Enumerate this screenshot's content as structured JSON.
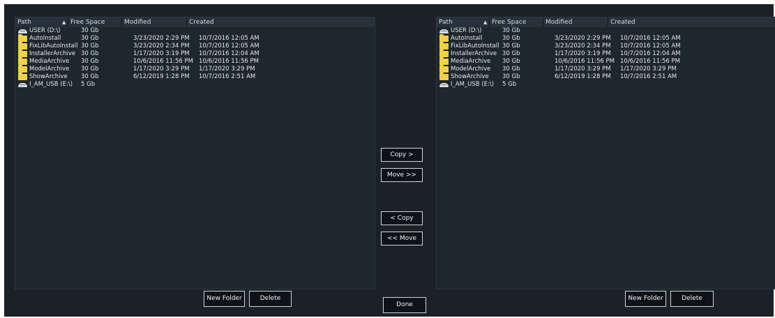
{
  "columns": {
    "path": "Path",
    "free_space": "Free Space",
    "modified": "Modified",
    "created": "Created"
  },
  "left_pane": {
    "rows": [
      {
        "icon": "drive-icon",
        "path": "USER (D:\\)",
        "free": "30 Gb",
        "modified": "",
        "created": ""
      },
      {
        "icon": "folder-icon",
        "path": "AutoInstall",
        "free": "30 Gb",
        "modified": "3/23/2020 2:29 PM",
        "created": "10/7/2016 12:05 AM"
      },
      {
        "icon": "folder-icon",
        "path": "FixLibAutoInstall",
        "free": "30 Gb",
        "modified": "3/23/2020 2:34 PM",
        "created": "10/7/2016 12:05 AM"
      },
      {
        "icon": "folder-icon",
        "path": "InstallerArchive",
        "free": "30 Gb",
        "modified": "1/17/2020 3:19 PM",
        "created": "10/7/2016 12:04 AM"
      },
      {
        "icon": "folder-icon",
        "path": "MediaArchive",
        "free": "30 Gb",
        "modified": "10/6/2016 11:56 PM",
        "created": "10/6/2016 11:56 PM"
      },
      {
        "icon": "folder-icon",
        "path": "ModelArchive",
        "free": "30 Gb",
        "modified": "1/17/2020 3:29 PM",
        "created": "1/17/2020 3:29 PM"
      },
      {
        "icon": "folder-icon",
        "path": "ShowArchive",
        "free": "30 Gb",
        "modified": "6/12/2019 1:28 PM",
        "created": "10/7/2016 2:51 AM"
      },
      {
        "icon": "drive-icon",
        "path": "I_AM_USB (E:\\)",
        "free": "5 Gb",
        "modified": "",
        "created": ""
      }
    ],
    "new_folder": "New Folder",
    "delete": "Delete"
  },
  "right_pane": {
    "rows": [
      {
        "icon": "drive-icon",
        "path": "USER (D:\\)",
        "free": "30 Gb",
        "modified": "",
        "created": ""
      },
      {
        "icon": "folder-icon",
        "path": "AutoInstall",
        "free": "30 Gb",
        "modified": "3/23/2020 2:29 PM",
        "created": "10/7/2016 12:05 AM"
      },
      {
        "icon": "folder-icon",
        "path": "FixLibAutoInstall",
        "free": "30 Gb",
        "modified": "3/23/2020 2:34 PM",
        "created": "10/7/2016 12:05 AM"
      },
      {
        "icon": "folder-icon",
        "path": "InstallerArchive",
        "free": "30 Gb",
        "modified": "1/17/2020 3:19 PM",
        "created": "10/7/2016 12:04 AM"
      },
      {
        "icon": "folder-icon",
        "path": "MediaArchive",
        "free": "30 Gb",
        "modified": "10/6/2016 11:56 PM",
        "created": "10/6/2016 11:56 PM"
      },
      {
        "icon": "folder-icon",
        "path": "ModelArchive",
        "free": "30 Gb",
        "modified": "1/17/2020 3:29 PM",
        "created": "1/17/2020 3:29 PM"
      },
      {
        "icon": "folder-icon",
        "path": "ShowArchive",
        "free": "30 Gb",
        "modified": "6/12/2019 1:28 PM",
        "created": "10/7/2016 2:51 AM"
      },
      {
        "icon": "drive-icon",
        "path": "I_AM_USB (E:\\)",
        "free": "5 Gb",
        "modified": "",
        "created": ""
      }
    ],
    "new_folder": "New Folder",
    "delete": "Delete"
  },
  "actions": {
    "copy_right": "Copy >",
    "move_right": "Move >>",
    "copy_left": "< Copy",
    "move_left": "<< Move",
    "done": "Done"
  },
  "colors": {
    "background": "#1b2127",
    "pane": "#1e262e",
    "header": "#26313b",
    "folder": "#f0d24a",
    "button_border": "#cfd6dc"
  }
}
